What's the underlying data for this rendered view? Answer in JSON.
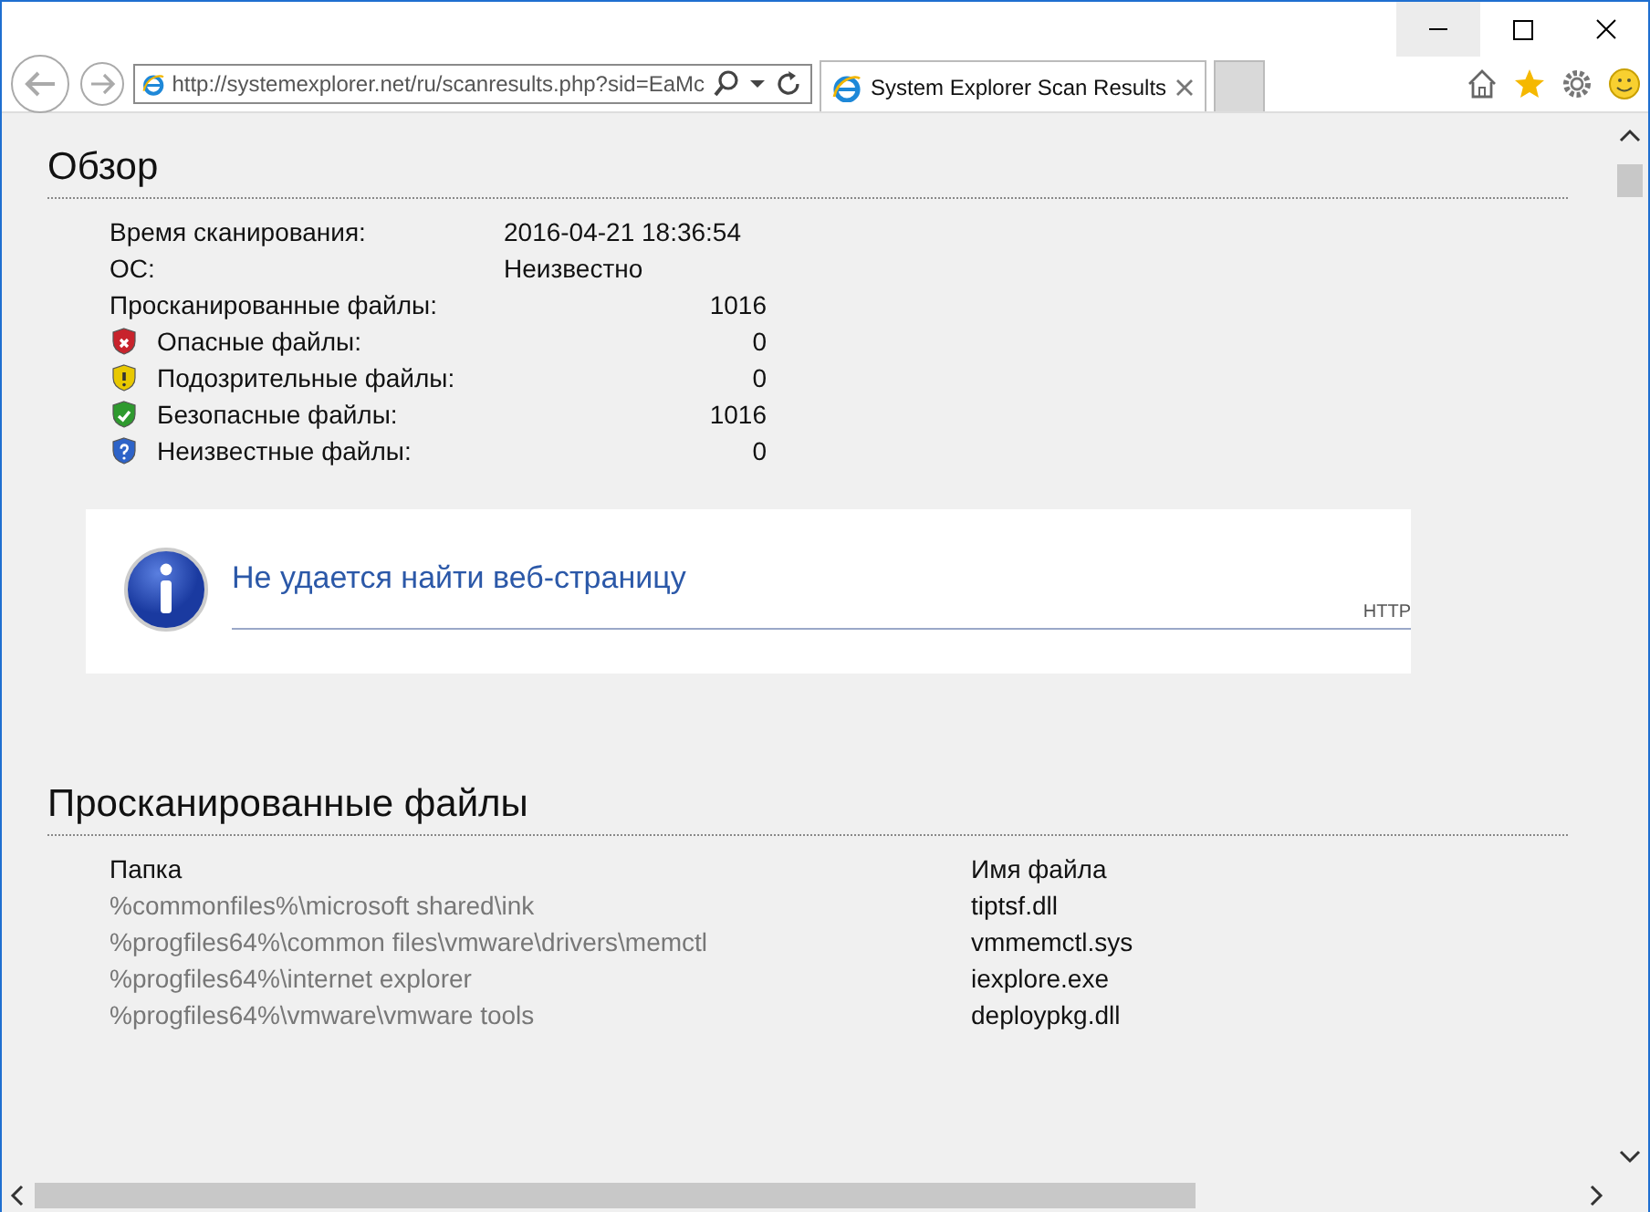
{
  "browser": {
    "address": "http://systemexplorer.net/ru/scanresults.php?sid=EaMc",
    "tabs": [
      {
        "title": "System Explorer Scan Results",
        "selected": true
      },
      {
        "selected": false
      }
    ]
  },
  "overview": {
    "heading": "Обзор",
    "rows": [
      {
        "kind": "info",
        "label": "Время сканирования:",
        "value": "2016-04-21 18:36:54"
      },
      {
        "kind": "info",
        "label": "ОС:",
        "value": "Неизвестно"
      },
      {
        "kind": "count",
        "label": "Просканированные файлы:",
        "value": "1016"
      },
      {
        "kind": "dangerous",
        "label": "Опасные файлы:",
        "value": "0"
      },
      {
        "kind": "suspicious",
        "label": "Подозрительные файлы:",
        "value": "0"
      },
      {
        "kind": "safe",
        "label": "Безопасные файлы:",
        "value": "1016"
      },
      {
        "kind": "unknown",
        "label": "Неизвестные файлы:",
        "value": "0"
      }
    ]
  },
  "error_frame": {
    "title": "Не удается найти веб-страницу",
    "side_label": "HTTP"
  },
  "scanned": {
    "heading": "Просканированные файлы",
    "columns": [
      "Папка",
      "Имя файла"
    ],
    "rows": [
      [
        "%commonfiles%\\microsoft shared\\ink",
        "tiptsf.dll"
      ],
      [
        "%progfiles64%\\common files\\vmware\\drivers\\memctl",
        "vmmemctl.sys"
      ],
      [
        "%progfiles64%\\internet explorer",
        "iexplore.exe"
      ],
      [
        "%progfiles64%\\vmware\\vmware tools",
        "deploypkg.dll"
      ]
    ]
  }
}
